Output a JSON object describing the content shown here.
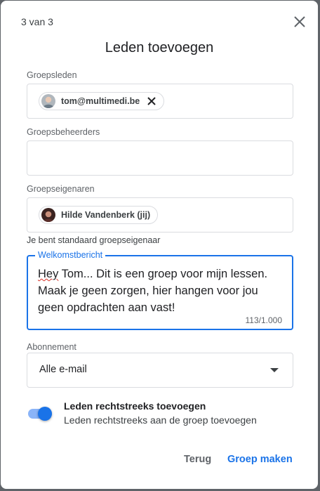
{
  "dialog": {
    "step": "3 van 3",
    "title": "Leden toevoegen"
  },
  "members": {
    "label": "Groepsleden",
    "chips": [
      {
        "text": "tom@multimedi.be"
      }
    ]
  },
  "managers": {
    "label": "Groepsbeheerders"
  },
  "owners": {
    "label": "Groepseigenaren",
    "chips": [
      {
        "text": "Hilde Vandenberk (jij)"
      }
    ],
    "hint": "Je bent standaard groepseigenaar"
  },
  "welcome": {
    "label": "Welkomstbericht",
    "text_first_word": "Hey",
    "text_rest": " Tom... Dit is een groep voor mijn lessen. Maak je geen zorgen, hier hangen voor jou geen opdrachten aan vast!",
    "counter": "113/1.000"
  },
  "subscription": {
    "label": "Abonnement",
    "value": "Alle e-mail"
  },
  "direct_add": {
    "title": "Leden rechtstreeks toevoegen",
    "description": "Leden rechtstreeks aan de groep toevoegen",
    "enabled": true
  },
  "buttons": {
    "back": "Terug",
    "create": "Groep maken"
  },
  "colors": {
    "accent": "#1a73e8",
    "toggle_track": "#8ab4f8"
  }
}
